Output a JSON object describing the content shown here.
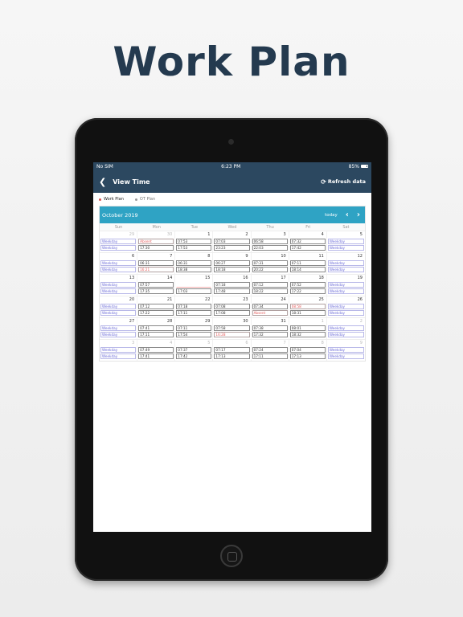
{
  "promo": {
    "title": "Work Plan"
  },
  "statusbar": {
    "carrier": "No SIM",
    "time": "6:23 PM",
    "battery": "85%"
  },
  "navbar": {
    "title": "View Time",
    "refresh_label": "Refresh data"
  },
  "tabs": [
    {
      "label": "Work Plan",
      "color": "#d9534f",
      "active": true
    },
    {
      "label": "OT Plan",
      "color": "#999999",
      "active": false
    }
  ],
  "calendar": {
    "month_title": "October 2019",
    "today_label": "today",
    "weekdays": [
      "Sun",
      "Mon",
      "Tue",
      "Wed",
      "Thu",
      "Fri",
      "Sat"
    ],
    "weeks": [
      {
        "days": [
          {
            "num": "29",
            "other": true,
            "slots": [
              {
                "t": "Weekday",
                "c": "rest"
              },
              {
                "t": "Weekday",
                "c": "rest"
              }
            ]
          },
          {
            "num": "30",
            "other": true,
            "slots": [
              {
                "t": "Absent",
                "c": "red"
              },
              {
                "t": "17:30",
                "c": ""
              }
            ]
          },
          {
            "num": "1",
            "slots": [
              {
                "t": "07:53",
                "c": ""
              },
              {
                "t": "17:53",
                "c": ""
              }
            ]
          },
          {
            "num": "2",
            "slots": [
              {
                "t": "07:03",
                "c": ""
              },
              {
                "t": "23:23",
                "c": ""
              }
            ]
          },
          {
            "num": "3",
            "slots": [
              {
                "t": "06:58",
                "c": ""
              },
              {
                "t": "22:03",
                "c": ""
              }
            ]
          },
          {
            "num": "4",
            "slots": [
              {
                "t": "07:32",
                "c": ""
              },
              {
                "t": "17:42",
                "c": ""
              }
            ]
          },
          {
            "num": "5",
            "slots": [
              {
                "t": "Weekday",
                "c": "rest"
              },
              {
                "t": "Weekday",
                "c": "rest"
              }
            ]
          }
        ]
      },
      {
        "days": [
          {
            "num": "6",
            "slots": [
              {
                "t": "Weekday",
                "c": "rest"
              },
              {
                "t": "Weekday",
                "c": "rest"
              }
            ]
          },
          {
            "num": "7",
            "slots": [
              {
                "t": "06:31",
                "c": ""
              },
              {
                "t": "16:21",
                "c": "red"
              }
            ]
          },
          {
            "num": "8",
            "slots": [
              {
                "t": "06:31",
                "c": ""
              },
              {
                "t": "18:38",
                "c": ""
              }
            ]
          },
          {
            "num": "9",
            "slots": [
              {
                "t": "06:27",
                "c": ""
              },
              {
                "t": "18:18",
                "c": ""
              }
            ]
          },
          {
            "num": "10",
            "slots": [
              {
                "t": "07:31",
                "c": ""
              },
              {
                "t": "20:22",
                "c": ""
              }
            ]
          },
          {
            "num": "11",
            "slots": [
              {
                "t": "07:11",
                "c": ""
              },
              {
                "t": "18:14",
                "c": ""
              }
            ]
          },
          {
            "num": "12",
            "slots": [
              {
                "t": "Weekday",
                "c": "rest"
              },
              {
                "t": "Weekday",
                "c": "rest"
              }
            ]
          }
        ]
      },
      {
        "days": [
          {
            "num": "13",
            "slots": [
              {
                "t": "Weekday",
                "c": "rest"
              },
              {
                "t": "Weekday",
                "c": "rest"
              }
            ]
          },
          {
            "num": "14",
            "slots": [
              {
                "t": "07:57",
                "c": ""
              },
              {
                "t": "17:35",
                "c": ""
              }
            ]
          },
          {
            "num": "15",
            "slots": [
              {
                "t": "",
                "c": "pink"
              },
              {
                "t": "17:03",
                "c": ""
              }
            ]
          },
          {
            "num": "16",
            "slots": [
              {
                "t": "07:18",
                "c": ""
              },
              {
                "t": "17:48",
                "c": ""
              }
            ]
          },
          {
            "num": "17",
            "slots": [
              {
                "t": "07:12",
                "c": ""
              },
              {
                "t": "18:22",
                "c": ""
              }
            ]
          },
          {
            "num": "18",
            "slots": [
              {
                "t": "07:52",
                "c": ""
              },
              {
                "t": "17:22",
                "c": ""
              }
            ]
          },
          {
            "num": "19",
            "slots": [
              {
                "t": "Weekday",
                "c": "rest"
              },
              {
                "t": "Weekday",
                "c": "rest"
              }
            ]
          }
        ]
      },
      {
        "days": [
          {
            "num": "20",
            "slots": [
              {
                "t": "Weekday",
                "c": "rest"
              },
              {
                "t": "Weekday",
                "c": "rest"
              }
            ]
          },
          {
            "num": "21",
            "slots": [
              {
                "t": "07:12",
                "c": ""
              },
              {
                "t": "17:22",
                "c": ""
              }
            ]
          },
          {
            "num": "22",
            "slots": [
              {
                "t": "07:18",
                "c": ""
              },
              {
                "t": "17:11",
                "c": ""
              }
            ]
          },
          {
            "num": "23",
            "slots": [
              {
                "t": "07:08",
                "c": ""
              },
              {
                "t": "17:08",
                "c": ""
              }
            ]
          },
          {
            "num": "24",
            "slots": [
              {
                "t": "07:34",
                "c": ""
              },
              {
                "t": "Absent",
                "c": "red"
              }
            ]
          },
          {
            "num": "25",
            "slots": [
              {
                "t": "08:58",
                "c": "red"
              },
              {
                "t": "18:31",
                "c": ""
              }
            ]
          },
          {
            "num": "26",
            "slots": [
              {
                "t": "Weekday",
                "c": "rest"
              },
              {
                "t": "Weekday",
                "c": "rest"
              }
            ]
          }
        ]
      },
      {
        "days": [
          {
            "num": "27",
            "slots": [
              {
                "t": "Weekday",
                "c": "rest"
              },
              {
                "t": "Weekday",
                "c": "rest"
              }
            ]
          },
          {
            "num": "28",
            "slots": [
              {
                "t": "07:41",
                "c": ""
              },
              {
                "t": "17:11",
                "c": ""
              }
            ]
          },
          {
            "num": "29",
            "slots": [
              {
                "t": "07:11",
                "c": ""
              },
              {
                "t": "17:54",
                "c": ""
              }
            ]
          },
          {
            "num": "30",
            "slots": [
              {
                "t": "07:58",
                "c": ""
              },
              {
                "t": "16:28",
                "c": "red"
              }
            ]
          },
          {
            "num": "31",
            "slots": [
              {
                "t": "07:38",
                "c": ""
              },
              {
                "t": "17:32",
                "c": ""
              }
            ]
          },
          {
            "num": "1",
            "other": true,
            "slots": [
              {
                "t": "08:01",
                "c": ""
              },
              {
                "t": "18:32",
                "c": ""
              }
            ]
          },
          {
            "num": "2",
            "other": true,
            "slots": [
              {
                "t": "Weekday",
                "c": "rest"
              },
              {
                "t": "Weekday",
                "c": "rest"
              }
            ]
          }
        ]
      },
      {
        "days": [
          {
            "num": "3",
            "other": true,
            "slots": [
              {
                "t": "Weekday",
                "c": "rest"
              },
              {
                "t": "Weekday",
                "c": "rest"
              }
            ]
          },
          {
            "num": "4",
            "other": true,
            "slots": [
              {
                "t": "07:49",
                "c": ""
              },
              {
                "t": "17:41",
                "c": ""
              }
            ]
          },
          {
            "num": "5",
            "other": true,
            "slots": [
              {
                "t": "07:37",
                "c": ""
              },
              {
                "t": "17:42",
                "c": ""
              }
            ]
          },
          {
            "num": "6",
            "other": true,
            "slots": [
              {
                "t": "07:17",
                "c": ""
              },
              {
                "t": "17:13",
                "c": ""
              }
            ]
          },
          {
            "num": "7",
            "other": true,
            "slots": [
              {
                "t": "07:24",
                "c": ""
              },
              {
                "t": "17:11",
                "c": ""
              }
            ]
          },
          {
            "num": "8",
            "other": true,
            "slots": [
              {
                "t": "07:04",
                "c": ""
              },
              {
                "t": "17:13",
                "c": ""
              }
            ]
          },
          {
            "num": "9",
            "other": true,
            "slots": [
              {
                "t": "Weekday",
                "c": "rest"
              },
              {
                "t": "Weekday",
                "c": "rest"
              }
            ]
          }
        ]
      }
    ]
  }
}
